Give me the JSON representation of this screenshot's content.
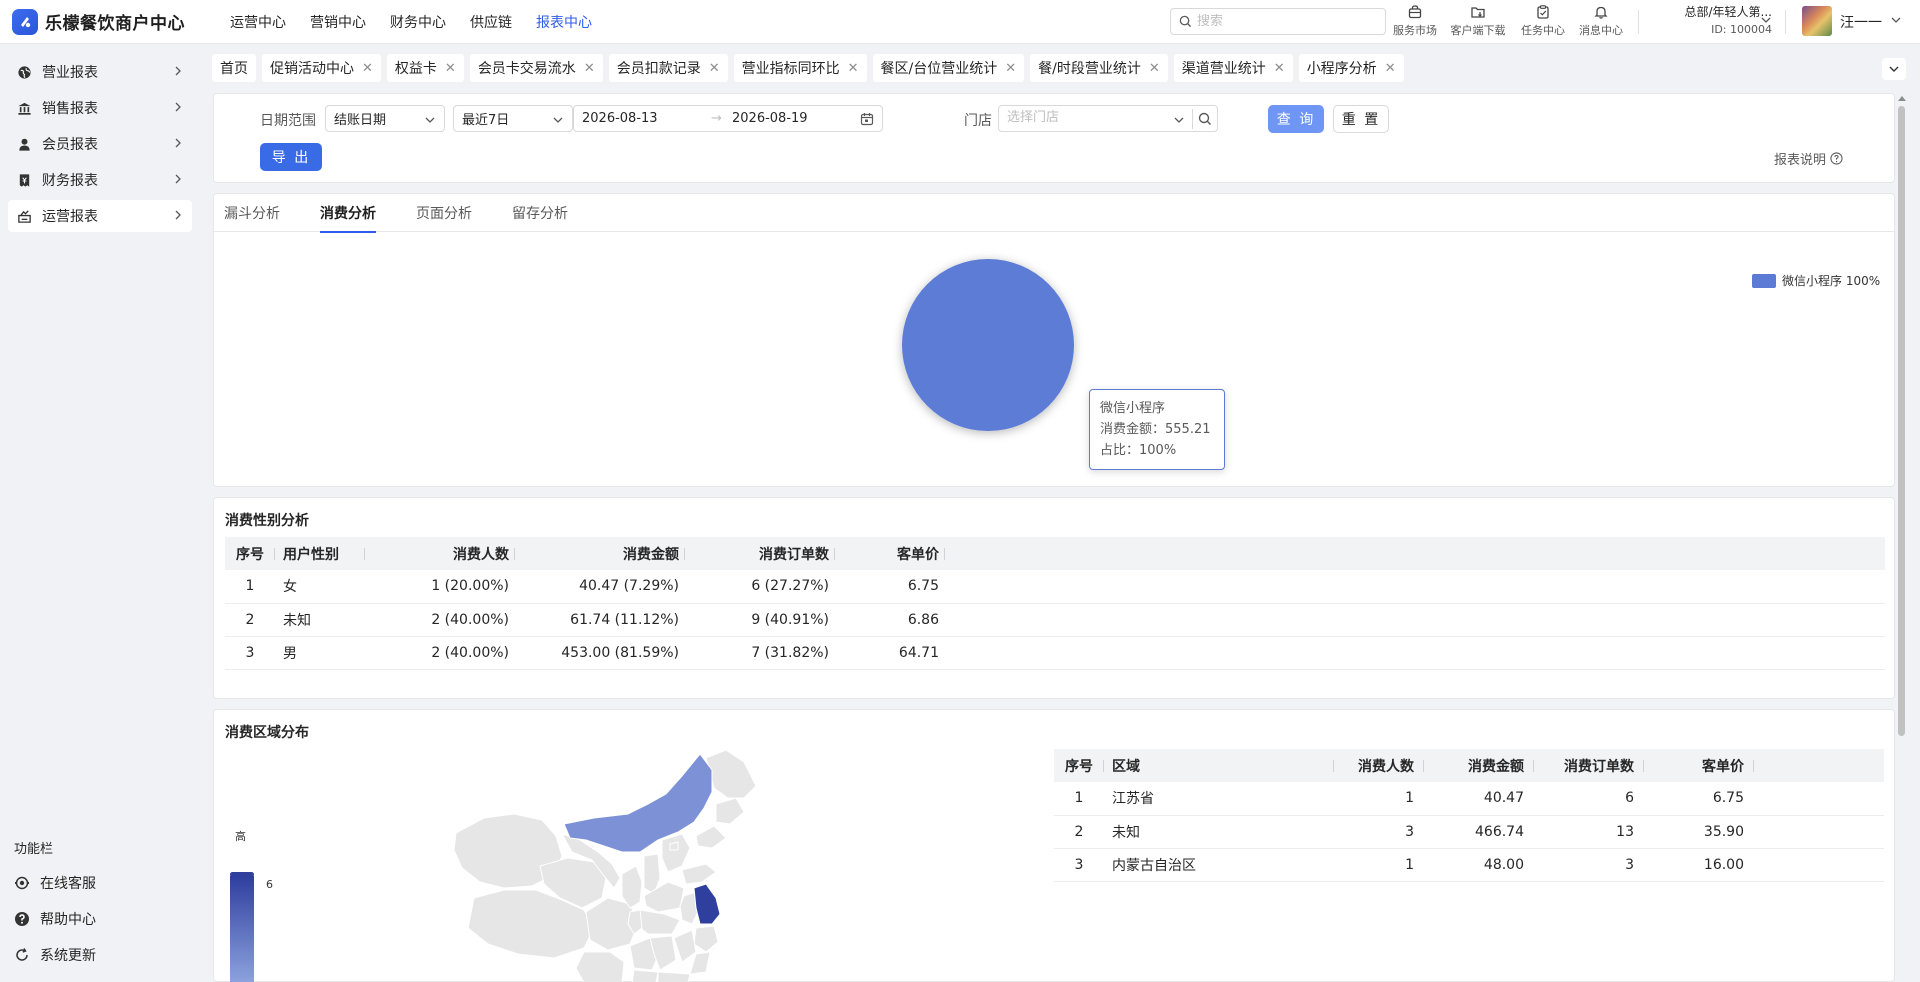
{
  "brand": {
    "name": "乐檬餐饮商户中心"
  },
  "topnav": [
    "运营中心",
    "营销中心",
    "财务中心",
    "供应链",
    "报表中心"
  ],
  "topnav_active": "报表中心",
  "search": {
    "placeholder": "搜索"
  },
  "tools": [
    {
      "label": "服务市场",
      "icon": "store-icon"
    },
    {
      "label": "客户端下载",
      "icon": "folder-download-icon"
    },
    {
      "label": "任务中心",
      "icon": "clipboard-icon"
    },
    {
      "label": "消息中心",
      "icon": "bell-icon"
    }
  ],
  "org": {
    "name": "总部/年轻人第...",
    "id": "ID: 100004"
  },
  "user": {
    "name": "汪一一"
  },
  "sidebar": {
    "items": [
      {
        "label": "营业报表",
        "icon": "globe-icon"
      },
      {
        "label": "销售报表",
        "icon": "bank-icon"
      },
      {
        "label": "会员报表",
        "icon": "person-icon"
      },
      {
        "label": "财务报表",
        "icon": "receipt-icon"
      },
      {
        "label": "运营报表",
        "icon": "chart-box-icon"
      }
    ],
    "active": "运营报表",
    "section_label": "功能栏",
    "func_items": [
      {
        "label": "在线客服",
        "icon": "headset-icon"
      },
      {
        "label": "帮助中心",
        "icon": "help-icon"
      },
      {
        "label": "系统更新",
        "icon": "refresh-icon"
      }
    ]
  },
  "tabs": [
    {
      "label": "首页",
      "closable": false
    },
    {
      "label": "促销活动中心",
      "closable": true
    },
    {
      "label": "权益卡",
      "closable": true
    },
    {
      "label": "会员卡交易流水",
      "closable": true
    },
    {
      "label": "会员扣款记录",
      "closable": true
    },
    {
      "label": "营业指标同环比",
      "closable": true
    },
    {
      "label": "餐区/台位营业统计",
      "closable": true
    },
    {
      "label": "餐/时段营业统计",
      "closable": true
    },
    {
      "label": "渠道营业统计",
      "closable": true
    },
    {
      "label": "小程序分析",
      "closable": true
    }
  ],
  "filters": {
    "date_range_label": "日期范围",
    "date_type": "结账日期",
    "preset": "最近7日",
    "start_date": "2026-08-13",
    "range_arrow": "→",
    "end_date": "2026-08-19",
    "store_label": "门店",
    "store_placeholder": "选择门店",
    "query_button": "查 询",
    "reset_button": "重 置",
    "export_button": "导 出",
    "report_help": "报表说明"
  },
  "analysis_tabs": [
    "漏斗分析",
    "消费分析",
    "页面分析",
    "留存分析"
  ],
  "analysis_active": "消费分析",
  "chart_data": {
    "type": "pie",
    "slices": [
      {
        "name": "微信小程序",
        "value": 555.21,
        "percent": 100
      }
    ],
    "legend": [
      "微信小程序 100%"
    ],
    "legend_position": "top-right",
    "color": "#5b7bd5",
    "tooltip": {
      "title": "微信小程序",
      "amount_line": "消费金额：555.21",
      "percent_line": "占比：100%"
    }
  },
  "gender": {
    "title": "消费性别分析",
    "columns": [
      "序号",
      "用户性别",
      "消费人数",
      "消费金额",
      "消费订单数",
      "客单价"
    ],
    "rows": [
      [
        "1",
        "女",
        "1 (20.00%)",
        "40.47 (7.29%)",
        "6 (27.27%)",
        "6.75"
      ],
      [
        "2",
        "未知",
        "2 (40.00%)",
        "61.74 (11.12%)",
        "9 (40.91%)",
        "6.86"
      ],
      [
        "3",
        "男",
        "2 (40.00%)",
        "453.00 (81.59%)",
        "7 (31.82%)",
        "64.71"
      ]
    ]
  },
  "region": {
    "title": "消费区域分布",
    "visual_map": {
      "high_label": "高",
      "max_value": "6"
    },
    "columns": [
      "序号",
      "区域",
      "消费人数",
      "消费金额",
      "消费订单数",
      "客单价"
    ],
    "rows": [
      [
        "1",
        "江苏省",
        "1",
        "40.47",
        "6",
        "6.75"
      ],
      [
        "2",
        "未知",
        "3",
        "466.74",
        "13",
        "35.90"
      ],
      [
        "3",
        "内蒙古自治区",
        "1",
        "48.00",
        "3",
        "16.00"
      ]
    ]
  },
  "colors": {
    "accent": "#2f5ce8",
    "pie": "#5b7bd5",
    "map_high": "#2e3f9e",
    "map_low": "#dfe5f6"
  }
}
